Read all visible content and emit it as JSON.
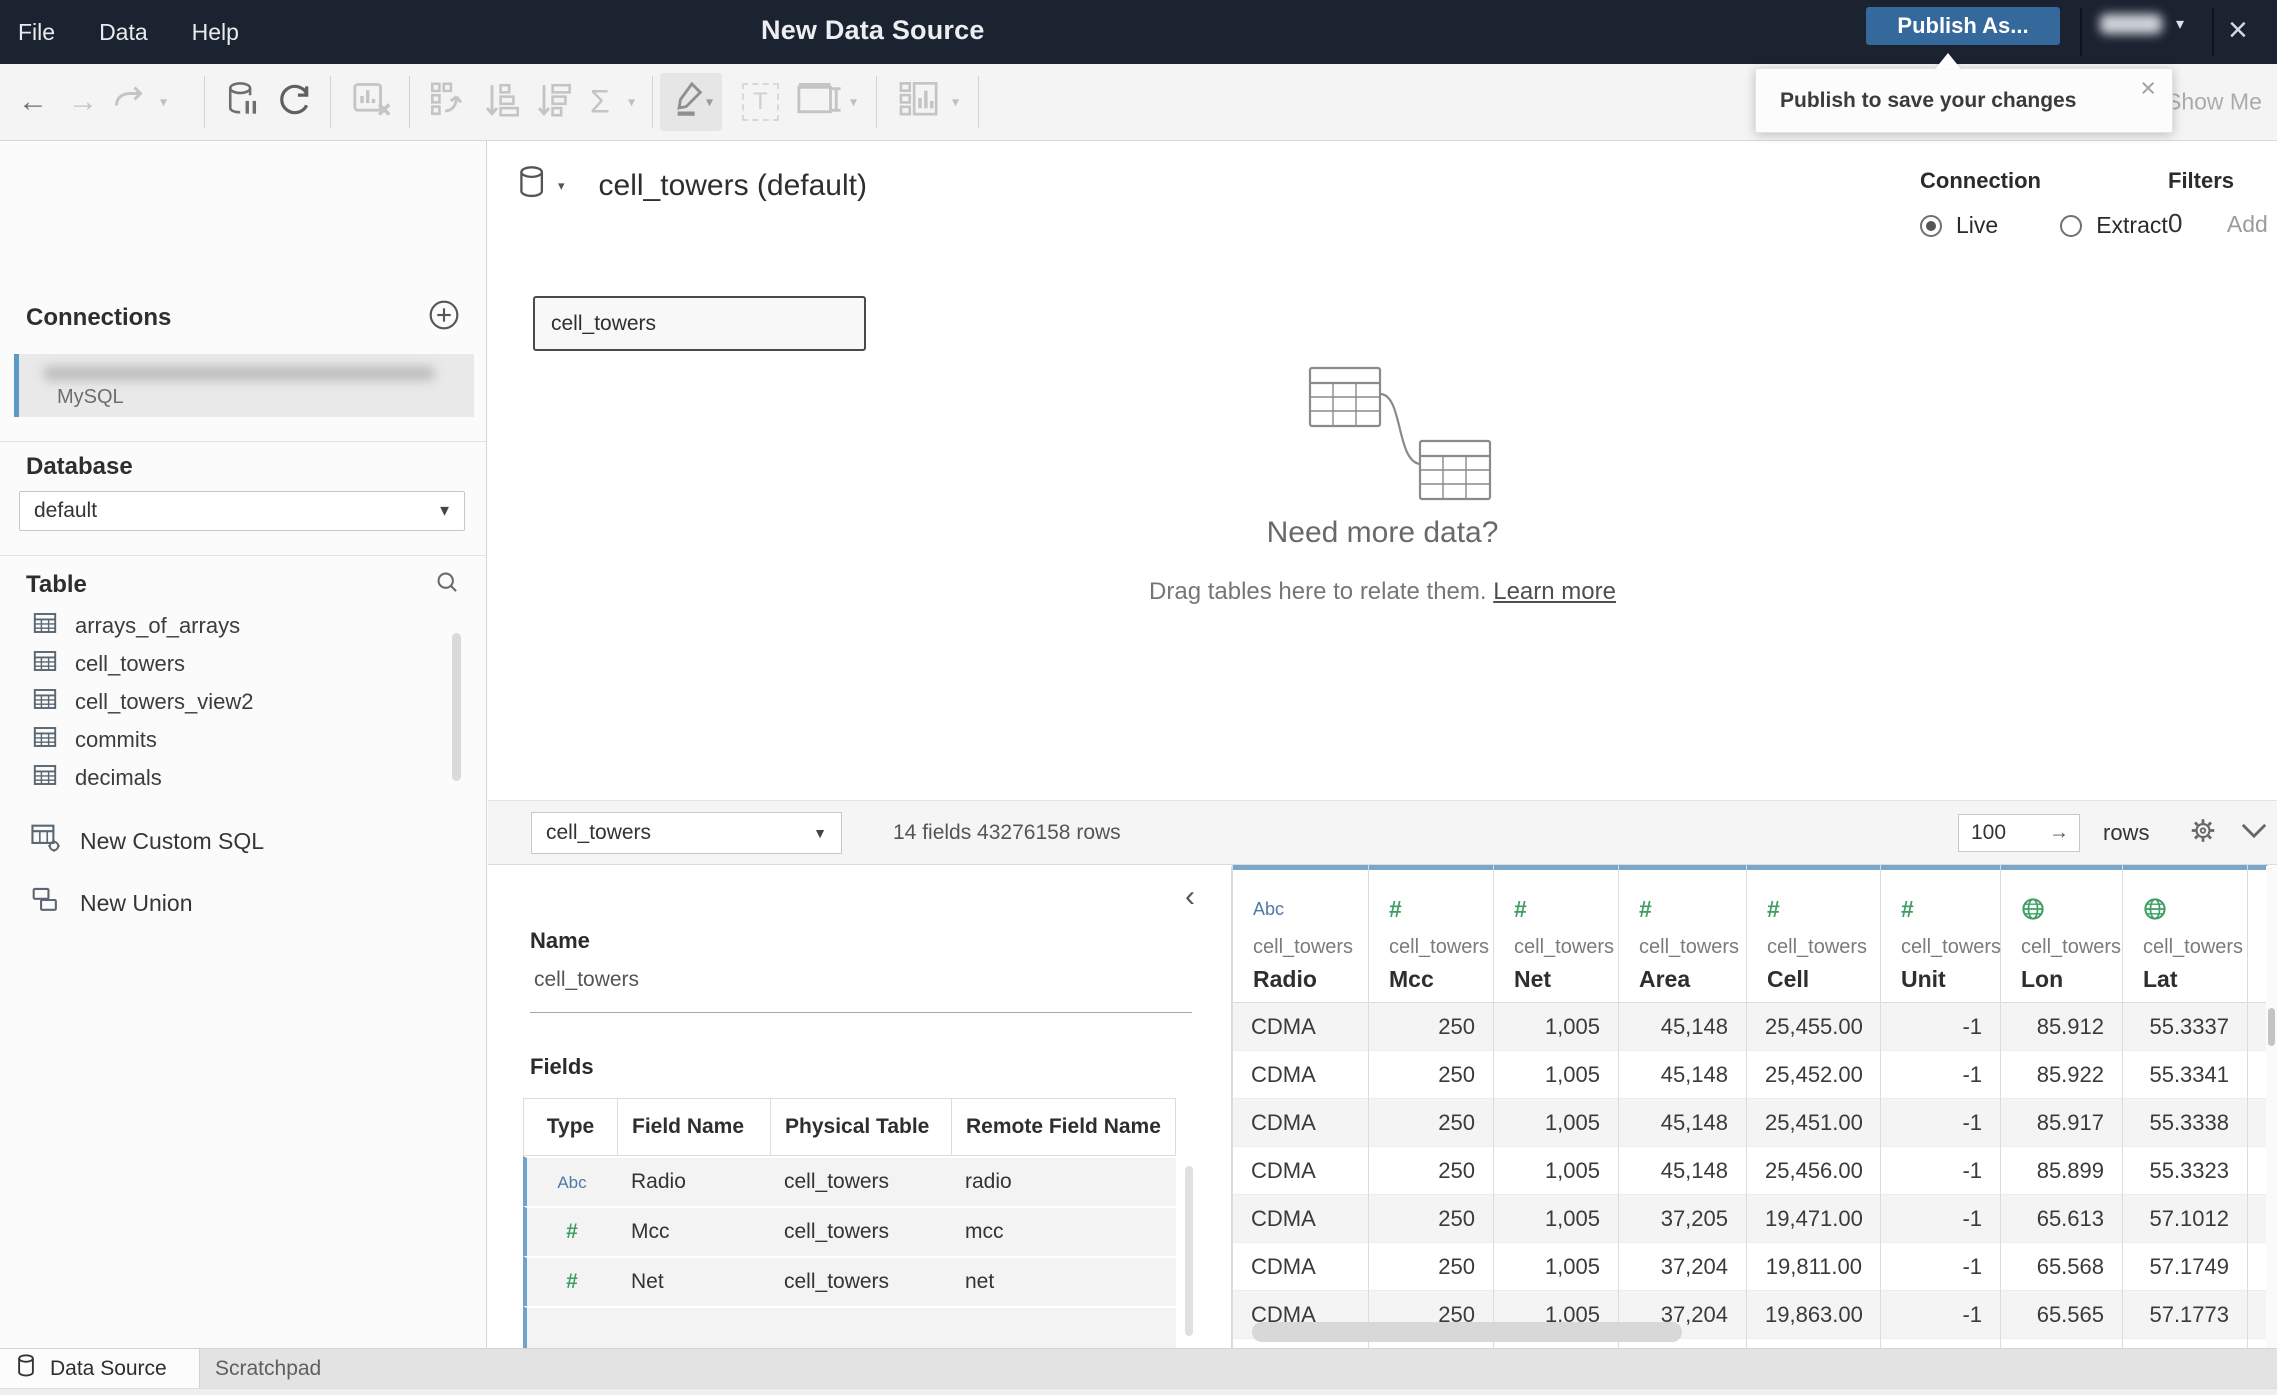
{
  "topbar": {
    "menus": [
      "File",
      "Data",
      "Help"
    ],
    "title": "New Data Source",
    "publish_button": "Publish As...",
    "close_glyph": "×",
    "tooltip": {
      "text": "Publish to save your changes",
      "close_glyph": "×"
    }
  },
  "toolbar": {
    "show_me": "Show Me",
    "sigma_glyph": "Σ",
    "back_glyph": "←",
    "forward_glyph": "→",
    "text_glyph": "T"
  },
  "sidebar": {
    "connections_label": "Connections",
    "connection": {
      "type": "MySQL"
    },
    "database_label": "Database",
    "database_value": "default",
    "table_label": "Table",
    "tables": [
      "arrays_of_arrays",
      "cell_towers",
      "cell_towers_view2",
      "commits",
      "decimals"
    ],
    "actions": [
      "New Custom SQL",
      "New Union"
    ]
  },
  "canvas": {
    "datasource_title": "cell_towers (default)",
    "connection_label": "Connection",
    "live_label": "Live",
    "extract_label": "Extract",
    "filters_label": "Filters",
    "filters_count": "0",
    "filters_add": "Add",
    "table_node": "cell_towers",
    "empty_title": "Need more data?",
    "empty_subtitle": "Drag tables here to relate them.",
    "learn_more": "Learn more"
  },
  "grid_toolbar": {
    "table_select": "cell_towers",
    "summary": "14 fields 43276158 rows",
    "row_count": "100",
    "rows_label": "rows",
    "go_glyph": "→"
  },
  "metadata": {
    "collapse_glyph": "‹",
    "name_label": "Name",
    "name_value": "cell_towers",
    "fields_label": "Fields",
    "columns": [
      "Type",
      "Field Name",
      "Physical Table",
      "Remote Field Name"
    ],
    "rows": [
      {
        "type": "Abc",
        "field": "Radio",
        "table": "cell_towers",
        "remote": "radio"
      },
      {
        "type": "#",
        "field": "Mcc",
        "table": "cell_towers",
        "remote": "mcc"
      },
      {
        "type": "#",
        "field": "Net",
        "table": "cell_towers",
        "remote": "net"
      }
    ]
  },
  "grid": {
    "columns": [
      {
        "icon": "Abc",
        "table": "cell_towers",
        "name": "Radio",
        "align": "left"
      },
      {
        "icon": "#",
        "table": "cell_towers",
        "name": "Mcc",
        "align": "right"
      },
      {
        "icon": "#",
        "table": "cell_towers",
        "name": "Net",
        "align": "right"
      },
      {
        "icon": "#",
        "table": "cell_towers",
        "name": "Area",
        "align": "right"
      },
      {
        "icon": "#",
        "table": "cell_towers",
        "name": "Cell",
        "align": "right"
      },
      {
        "icon": "#",
        "table": "cell_towers",
        "name": "Unit",
        "align": "right"
      },
      {
        "icon": "globe",
        "table": "cell_towers",
        "name": "Lon",
        "align": "right"
      },
      {
        "icon": "globe",
        "table": "cell_towers",
        "name": "Lat",
        "align": "right"
      }
    ],
    "rows": [
      [
        "CDMA",
        "250",
        "1,005",
        "45,148",
        "25,455.00",
        "-1",
        "85.912",
        "55.3337"
      ],
      [
        "CDMA",
        "250",
        "1,005",
        "45,148",
        "25,452.00",
        "-1",
        "85.922",
        "55.3341"
      ],
      [
        "CDMA",
        "250",
        "1,005",
        "45,148",
        "25,451.00",
        "-1",
        "85.917",
        "55.3338"
      ],
      [
        "CDMA",
        "250",
        "1,005",
        "45,148",
        "25,456.00",
        "-1",
        "85.899",
        "55.3323"
      ],
      [
        "CDMA",
        "250",
        "1,005",
        "37,205",
        "19,471.00",
        "-1",
        "65.613",
        "57.1012"
      ],
      [
        "CDMA",
        "250",
        "1,005",
        "37,204",
        "19,811.00",
        "-1",
        "65.568",
        "57.1749"
      ],
      [
        "CDMA",
        "250",
        "1,005",
        "37,204",
        "19,863.00",
        "-1",
        "65.565",
        "57.1773"
      ]
    ]
  },
  "tabs": {
    "active": "Data Source",
    "inactive": "Scratchpad"
  },
  "colors": {
    "topbar": "#1c2330",
    "publish_blue": "#35699b",
    "accent_blue": "#5b99c6",
    "grid_header_blue": "#7ca6c7",
    "abc_blue": "#4e79a7",
    "number_green": "#3f9e63"
  }
}
